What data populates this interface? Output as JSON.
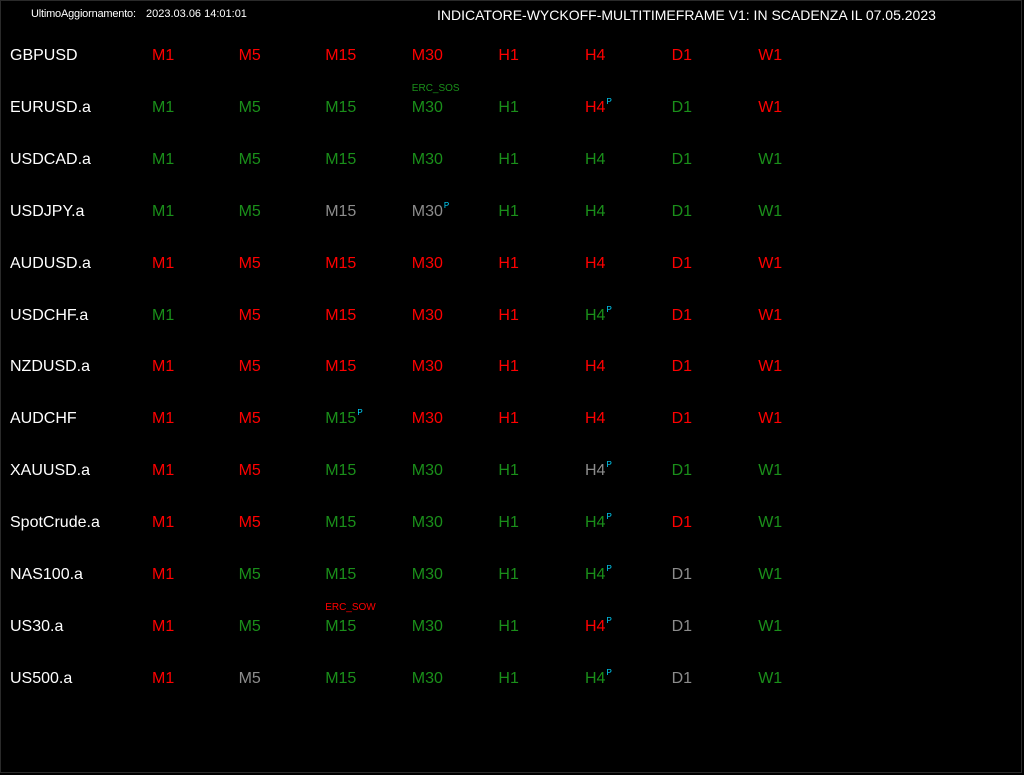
{
  "header": {
    "update_label": "UltimoAggiornamento:",
    "update_value": "2023.03.06 14:01:01",
    "title": "INDICATORE-WYCKOFF-MULTITIMEFRAME V1: IN SCADENZA IL 07.05.2023"
  },
  "colors": {
    "R": "#ff0000",
    "G": "#1a8f1a",
    "Y": "#8c8c8c",
    "text": "#ffffff",
    "marker": "#00d5ff"
  },
  "marker_symbol": "P",
  "timeframes": [
    "M1",
    "M5",
    "M15",
    "M30",
    "H1",
    "H4",
    "D1",
    "W1"
  ],
  "rows": [
    {
      "symbol": "GBPUSD",
      "states": [
        "R",
        "R",
        "R",
        "R",
        "R",
        "R",
        "R",
        "R"
      ],
      "markers": [
        0,
        0,
        0,
        0,
        0,
        0,
        0,
        0
      ]
    },
    {
      "symbol": "EURUSD.a",
      "states": [
        "G",
        "G",
        "G",
        "G",
        "G",
        "R",
        "G",
        "R"
      ],
      "markers": [
        0,
        0,
        0,
        0,
        0,
        1,
        0,
        0
      ]
    },
    {
      "symbol": "USDCAD.a",
      "states": [
        "G",
        "G",
        "G",
        "G",
        "G",
        "G",
        "G",
        "G"
      ],
      "markers": [
        0,
        0,
        0,
        0,
        0,
        0,
        0,
        0
      ]
    },
    {
      "symbol": "USDJPY.a",
      "states": [
        "G",
        "G",
        "Y",
        "Y",
        "G",
        "G",
        "G",
        "G"
      ],
      "markers": [
        0,
        0,
        0,
        1,
        0,
        0,
        0,
        0
      ]
    },
    {
      "symbol": "AUDUSD.a",
      "states": [
        "R",
        "R",
        "R",
        "R",
        "R",
        "R",
        "R",
        "R"
      ],
      "markers": [
        0,
        0,
        0,
        0,
        0,
        0,
        0,
        0
      ]
    },
    {
      "symbol": "USDCHF.a",
      "states": [
        "G",
        "R",
        "R",
        "R",
        "R",
        "G",
        "R",
        "R"
      ],
      "markers": [
        0,
        0,
        0,
        0,
        0,
        1,
        0,
        0
      ]
    },
    {
      "symbol": "NZDUSD.a",
      "states": [
        "R",
        "R",
        "R",
        "R",
        "R",
        "R",
        "R",
        "R"
      ],
      "markers": [
        0,
        0,
        0,
        0,
        0,
        0,
        0,
        0
      ]
    },
    {
      "symbol": "AUDCHF",
      "states": [
        "R",
        "R",
        "G",
        "R",
        "R",
        "R",
        "R",
        "R"
      ],
      "markers": [
        0,
        0,
        1,
        0,
        0,
        0,
        0,
        0
      ]
    },
    {
      "symbol": "XAUUSD.a",
      "states": [
        "R",
        "R",
        "G",
        "G",
        "G",
        "Y",
        "G",
        "G"
      ],
      "markers": [
        0,
        0,
        0,
        0,
        0,
        1,
        0,
        0
      ]
    },
    {
      "symbol": "SpotCrude.a",
      "states": [
        "R",
        "R",
        "G",
        "G",
        "G",
        "G",
        "R",
        "G"
      ],
      "markers": [
        0,
        0,
        0,
        0,
        0,
        1,
        0,
        0
      ]
    },
    {
      "symbol": "NAS100.a",
      "states": [
        "R",
        "G",
        "G",
        "G",
        "G",
        "G",
        "Y",
        "G"
      ],
      "markers": [
        0,
        0,
        0,
        0,
        0,
        1,
        0,
        0
      ]
    },
    {
      "symbol": "US30.a",
      "states": [
        "R",
        "G",
        "G",
        "G",
        "G",
        "R",
        "Y",
        "G"
      ],
      "markers": [
        0,
        0,
        0,
        0,
        0,
        1,
        0,
        0
      ]
    },
    {
      "symbol": "US500.a",
      "states": [
        "R",
        "Y",
        "G",
        "G",
        "G",
        "G",
        "Y",
        "G"
      ],
      "markers": [
        0,
        0,
        0,
        0,
        0,
        1,
        0,
        0
      ]
    }
  ],
  "annotations": [
    {
      "text": "ERC_SOS",
      "row": 1,
      "col": 3,
      "color": "G"
    },
    {
      "text": "ERC_SOW",
      "row": 11,
      "col": 2,
      "color": "R"
    }
  ]
}
